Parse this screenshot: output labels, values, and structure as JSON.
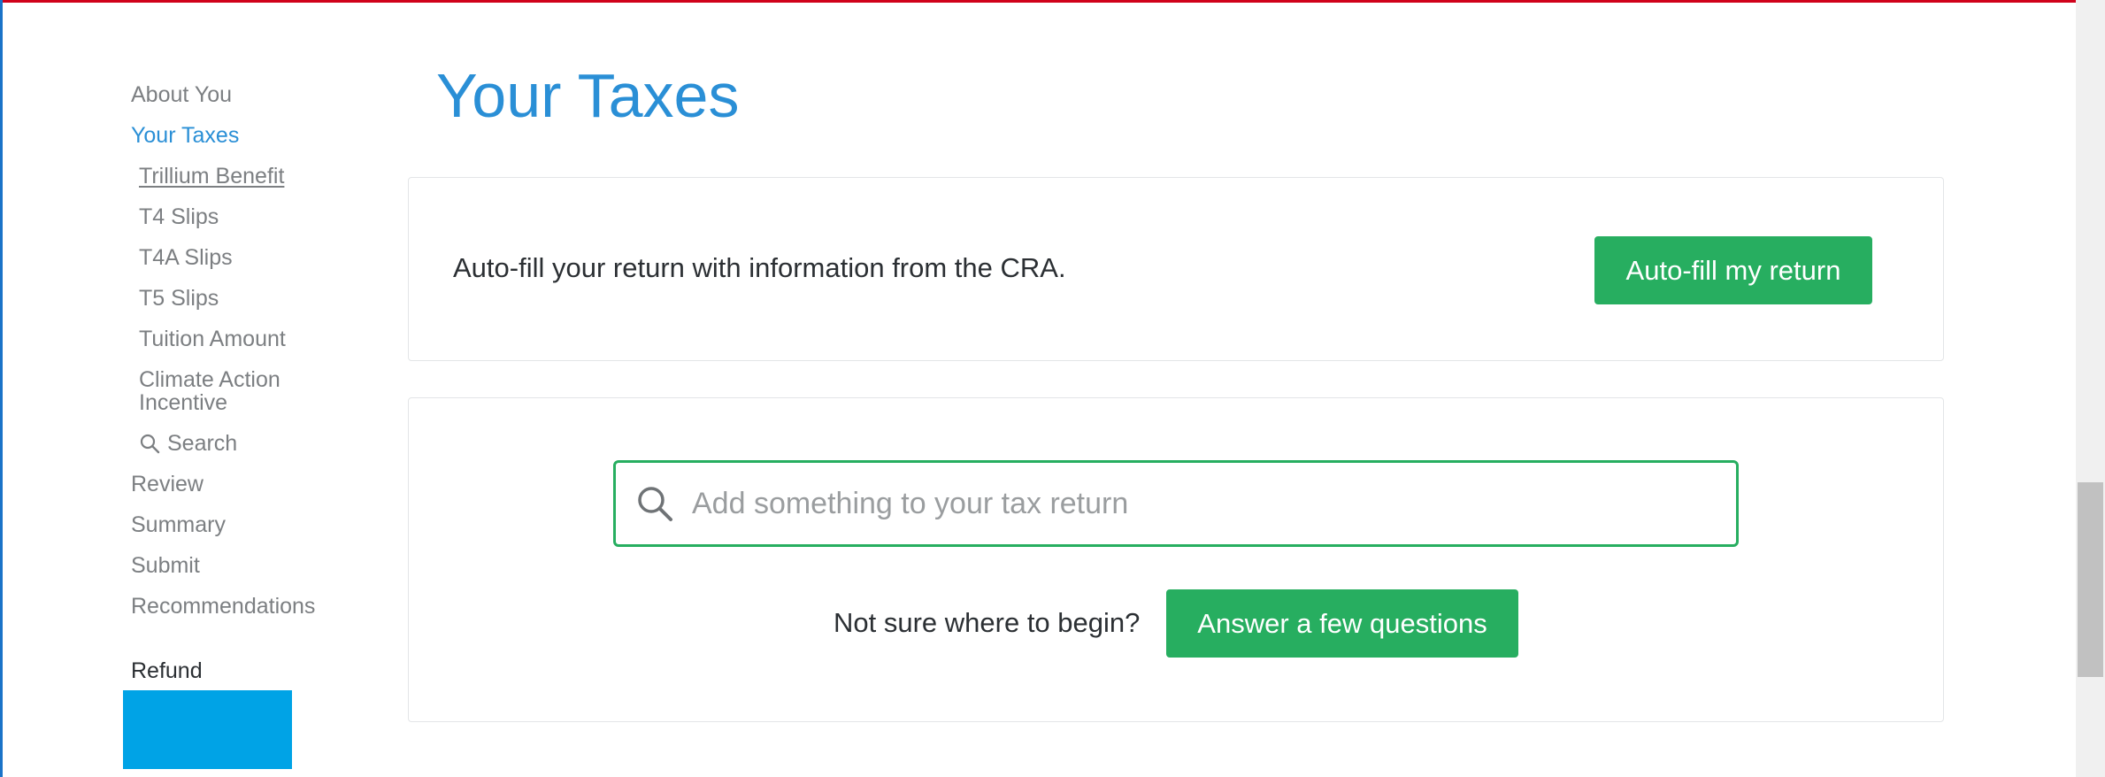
{
  "sidebar": {
    "items": [
      {
        "label": "About You"
      },
      {
        "label": "Your Taxes"
      },
      {
        "label": "Trillium Benefit"
      },
      {
        "label": "T4 Slips"
      },
      {
        "label": "T4A Slips"
      },
      {
        "label": "T5 Slips"
      },
      {
        "label": "Tuition Amount"
      },
      {
        "label": "Climate Action Incentive"
      },
      {
        "label": "Search",
        "icon": "search-icon"
      },
      {
        "label": "Review"
      },
      {
        "label": "Summary"
      },
      {
        "label": "Submit"
      },
      {
        "label": "Recommendations"
      }
    ],
    "refund_label": "Refund"
  },
  "main": {
    "title": "Your Taxes",
    "autofill": {
      "text": "Auto-fill your return with information from the CRA.",
      "button_label": "Auto-fill my return"
    },
    "search": {
      "placeholder": "Add something to your tax return",
      "value": "",
      "prompt": "Not sure where to begin?",
      "button_label": "Answer a few questions"
    }
  },
  "colors": {
    "accent_blue": "#2a8fd6",
    "button_green": "#27ae60",
    "refund_box": "#00a3e6",
    "top_border_red": "#d0021b"
  }
}
